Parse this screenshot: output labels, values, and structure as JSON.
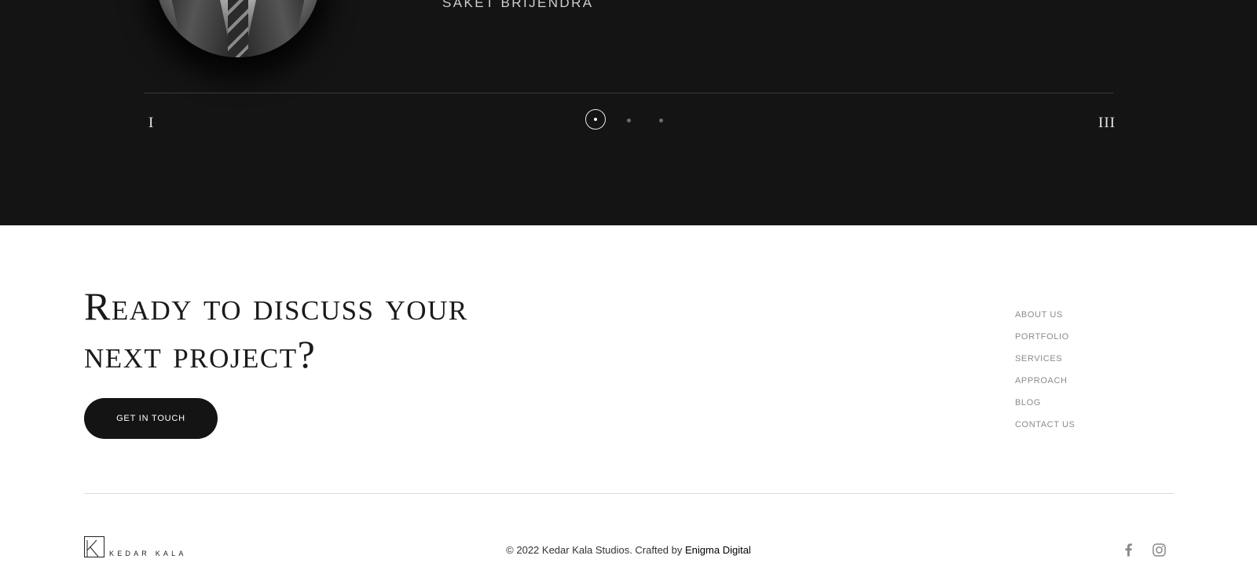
{
  "testimonial": {
    "person_name": "SAKET BRIJENDRA",
    "prev_slide_label": "I",
    "next_slide_label": "III",
    "pagination": {
      "total": 3,
      "active": 1
    }
  },
  "cta": {
    "headline_line1": "Ready to discuss your",
    "headline_line2": "next project?",
    "button_label": "GET IN TOUCH"
  },
  "footer_nav": {
    "items": [
      {
        "label": "ABOUT US"
      },
      {
        "label": "PORTFOLIO"
      },
      {
        "label": "SERVICES"
      },
      {
        "label": "APPROACH"
      },
      {
        "label": "BLOG"
      },
      {
        "label": "CONTACT US"
      }
    ]
  },
  "footer": {
    "logo_text": "KEDAR KALA",
    "copyright_text": "© 2022 Kedar Kala Studios. Crafted by ",
    "credit_link": "Enigma Digital",
    "social": [
      {
        "icon": "facebook-icon"
      },
      {
        "icon": "instagram-icon"
      }
    ]
  },
  "colors": {
    "dark_bg": "#141414",
    "page_bg": "#ffffff",
    "nav_text": "#8b8b8b",
    "button_bg": "#141414"
  }
}
